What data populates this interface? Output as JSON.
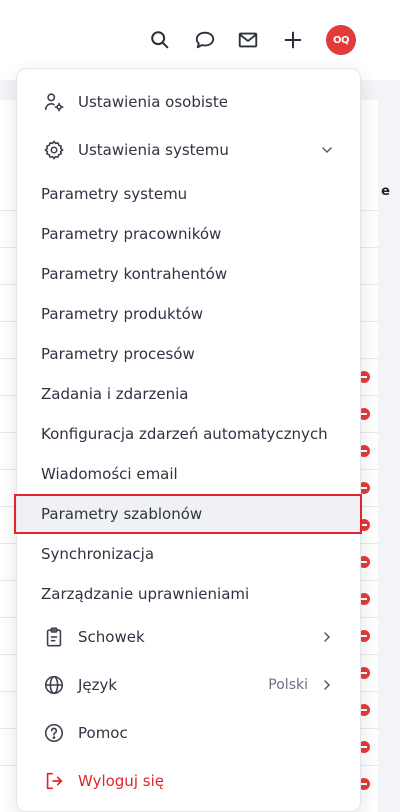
{
  "header": {
    "icons": [
      "search-icon",
      "chat-icon",
      "mail-icon",
      "plus-icon"
    ],
    "avatar_initials": "OQ",
    "avatar_color": "#e23b3b"
  },
  "background_table": {
    "header_fragment": "e"
  },
  "menu": {
    "personal_settings": "Ustawienia osobiste",
    "system_settings": "Ustawienia systemu",
    "submenu": [
      "Parametry systemu",
      "Parametry pracowników",
      "Parametry kontrahentów",
      "Parametry produktów",
      "Parametry procesów",
      "Zadania i zdarzenia",
      "Konfiguracja zdarzeń automatycznych",
      "Wiadomości email",
      "Parametry szablonów",
      "Synchronizacja",
      "Zarządzanie uprawnieniami"
    ],
    "clipboard": "Schowek",
    "language": "Język",
    "language_value": "Polski",
    "help": "Pomoc",
    "logout": "Wyloguj się"
  },
  "colors": {
    "accent": "#e0262b",
    "text": "#2f3441",
    "highlight_bg": "#f0f1f5"
  }
}
